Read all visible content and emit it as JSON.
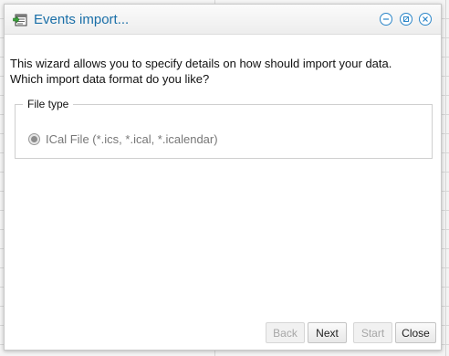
{
  "window": {
    "title": "Events import...",
    "controls": [
      "minimize",
      "maximize",
      "close"
    ]
  },
  "intro": {
    "line1": "This wizard allows you to specify details on how should import your data.",
    "line2": "Which import data format do you like?"
  },
  "file_type": {
    "legend": "File type",
    "option_label": "ICal File (*.ics, *.ical, *.icalendar)",
    "selected": true
  },
  "buttons": {
    "back": "Back",
    "next": "Next",
    "start": "Start",
    "close": "Close"
  },
  "colors": {
    "title": "#1a6fa8",
    "window_control": "#2c86c8"
  },
  "icons": {
    "app": "calendar-import-icon",
    "minimize": "minimize-icon",
    "maximize": "maximize-icon",
    "close": "close-icon"
  }
}
